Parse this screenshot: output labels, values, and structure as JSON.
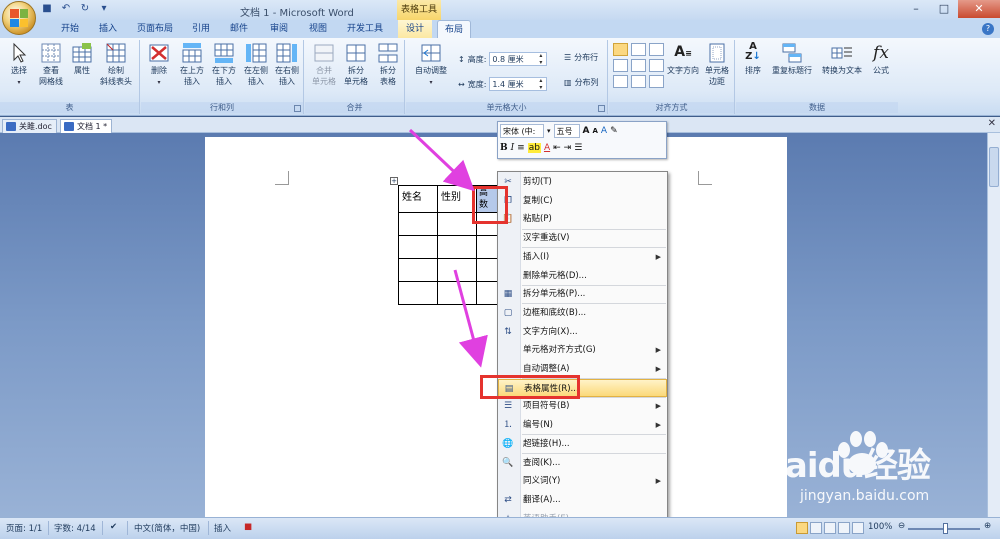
{
  "window": {
    "title": "文档 1 - Microsoft Word",
    "context_tab_title": "表格工具"
  },
  "tabs": [
    "开始",
    "插入",
    "页面布局",
    "引用",
    "邮件",
    "审阅",
    "视图",
    "开发工具",
    "设计",
    "布局"
  ],
  "active_tab": "布局",
  "ribbon": {
    "groups": {
      "table": {
        "label": "表",
        "buttons": [
          "选择",
          "查看\n网格线",
          "属性",
          "绘制\n斜线表头"
        ]
      },
      "rows_cols": {
        "label": "行和列",
        "buttons": [
          "删除",
          "在上方\n插入",
          "在下方\n插入",
          "在左侧\n插入",
          "在右侧\n插入"
        ]
      },
      "merge": {
        "label": "合并",
        "buttons": [
          "合并\n单元格",
          "拆分\n单元格",
          "拆分\n表格"
        ]
      },
      "cell_size": {
        "label": "单元格大小",
        "autofit": "自动调整",
        "height_label": "高度:",
        "height_value": "0.8 厘米",
        "width_label": "宽度:",
        "width_value": "1.4 厘米",
        "dist_rows": "分布行",
        "dist_cols": "分布列"
      },
      "alignment": {
        "label": "对齐方式",
        "buttons": [
          "文字方向",
          "单元格\n边距"
        ]
      },
      "data": {
        "label": "数据",
        "buttons": [
          "排序",
          "重复标题行",
          "转换为文本",
          "公式"
        ]
      }
    }
  },
  "doc_tabs": [
    {
      "name": "关雎.doc",
      "active": false
    },
    {
      "name": "文档 1 *",
      "active": true
    }
  ],
  "document": {
    "table": {
      "rows": [
        [
          "姓名",
          "性别",
          "高\n数"
        ],
        [
          "",
          "",
          ""
        ],
        [
          "",
          "",
          ""
        ],
        [
          "",
          "",
          ""
        ],
        [
          "",
          "",
          ""
        ]
      ]
    }
  },
  "mini_toolbar": {
    "font": "宋体 (中:",
    "size": "五号",
    "buttons": [
      "A",
      "A",
      "A",
      "B",
      "I",
      "A"
    ]
  },
  "context_menu": {
    "items": [
      {
        "label": "剪切(T)",
        "icon": "scissors-icon"
      },
      {
        "label": "复制(C)",
        "icon": "copy-icon"
      },
      {
        "label": "粘贴(P)",
        "icon": "paste-icon"
      },
      {
        "label": "汉字重选(V)",
        "icon": ""
      },
      {
        "label": "插入(I)",
        "icon": "",
        "submenu": true
      },
      {
        "label": "删除单元格(D)...",
        "icon": ""
      },
      {
        "label": "拆分单元格(P)...",
        "icon": "split-cells-icon"
      },
      {
        "label": "边框和底纹(B)...",
        "icon": "borders-icon"
      },
      {
        "label": "文字方向(X)...",
        "icon": "text-direction-icon"
      },
      {
        "label": "单元格对齐方式(G)",
        "icon": "",
        "submenu": true
      },
      {
        "label": "自动调整(A)",
        "icon": "",
        "submenu": true
      },
      {
        "label": "表格属性(R)...",
        "icon": "table-properties-icon",
        "highlighted": true
      },
      {
        "label": "项目符号(B)",
        "icon": "bullets-icon",
        "submenu": true
      },
      {
        "label": "编号(N)",
        "icon": "numbering-icon",
        "submenu": true
      },
      {
        "label": "超链接(H)...",
        "icon": "hyperlink-icon"
      },
      {
        "label": "查阅(K)...",
        "icon": "lookup-icon"
      },
      {
        "label": "同义词(Y)",
        "icon": "",
        "submenu": true
      },
      {
        "label": "翻译(A)...",
        "icon": "translate-icon"
      },
      {
        "label": "英语助手(E)",
        "icon": "english-assistant-icon",
        "disabled": true
      }
    ]
  },
  "statusbar": {
    "page": "页面: 1/1",
    "words": "字数: 4/14",
    "language": "中文(简体，中国)",
    "mode": "插入",
    "zoom": "100%"
  },
  "watermark": {
    "brand": "Baidu经验",
    "url": "jingyan.baidu.com"
  },
  "colors": {
    "accent": "#e5332e",
    "arrow": "#e040e0",
    "highlight": "#fbd97a"
  }
}
